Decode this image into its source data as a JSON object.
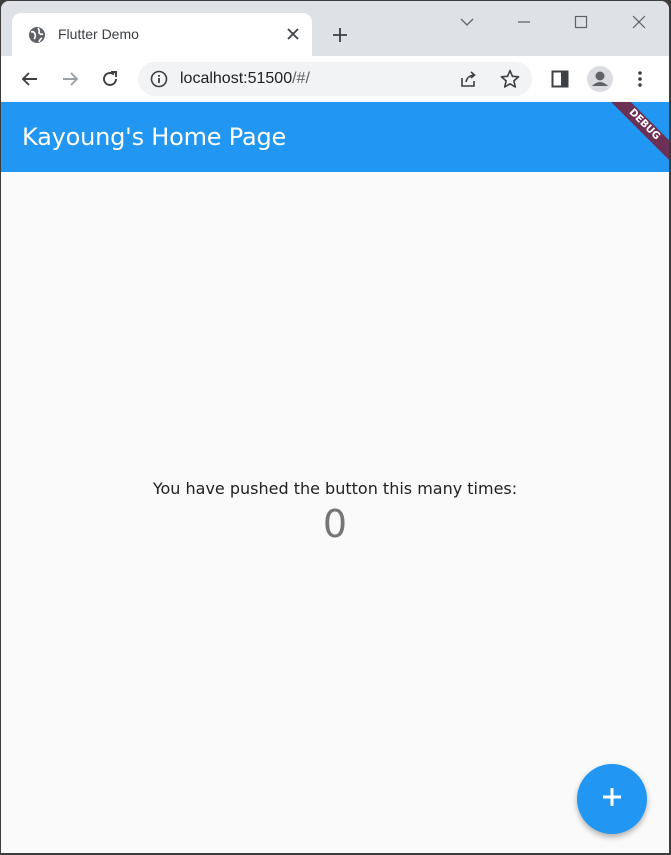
{
  "browser": {
    "tab": {
      "title": "Flutter Demo",
      "icon": "globe-icon"
    },
    "address": {
      "host": "localhost:51500",
      "path": "/#/"
    }
  },
  "app": {
    "title": "Kayoung's Home Page",
    "banner": "DEBUG",
    "accent": "#2196f3",
    "counter_label": "You have pushed the button this many times:",
    "counter_value": "0",
    "fab_icon": "plus-icon"
  }
}
